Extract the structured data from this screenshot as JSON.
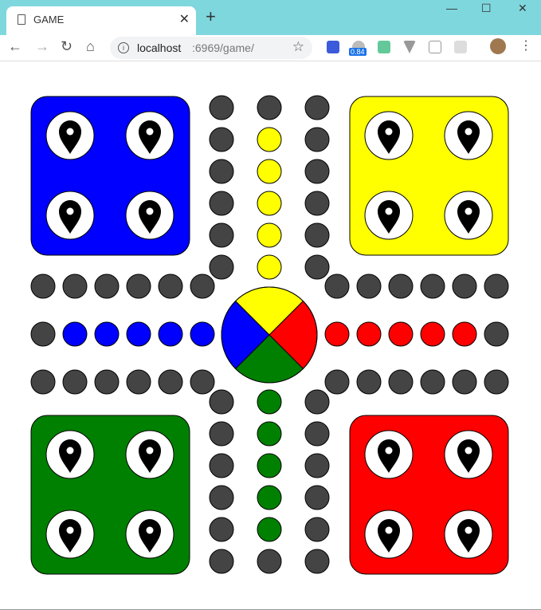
{
  "browser": {
    "tab_title": "GAME",
    "url_host": "localhost",
    "url_path": ":6969/game/",
    "extension_badge": "0.84"
  },
  "board": {
    "colors": {
      "blue": "#0000ff",
      "yellow": "#ffff00",
      "red": "#ff0000",
      "green": "#008000",
      "empty": "#444444",
      "token": "#000000"
    },
    "homes": [
      {
        "color": "blue",
        "corner": "top-left",
        "tokens": 4
      },
      {
        "color": "yellow",
        "corner": "top-right",
        "tokens": 4
      },
      {
        "color": "green",
        "corner": "bottom-left",
        "tokens": 4
      },
      {
        "color": "red",
        "corner": "bottom-right",
        "tokens": 4
      }
    ],
    "center": {
      "quadrants": [
        "yellow",
        "red",
        "green",
        "blue"
      ]
    },
    "home_paths": {
      "yellow": 5,
      "blue": 5,
      "red": 5,
      "green": 5
    },
    "token_icon": "map-pin-icon"
  }
}
